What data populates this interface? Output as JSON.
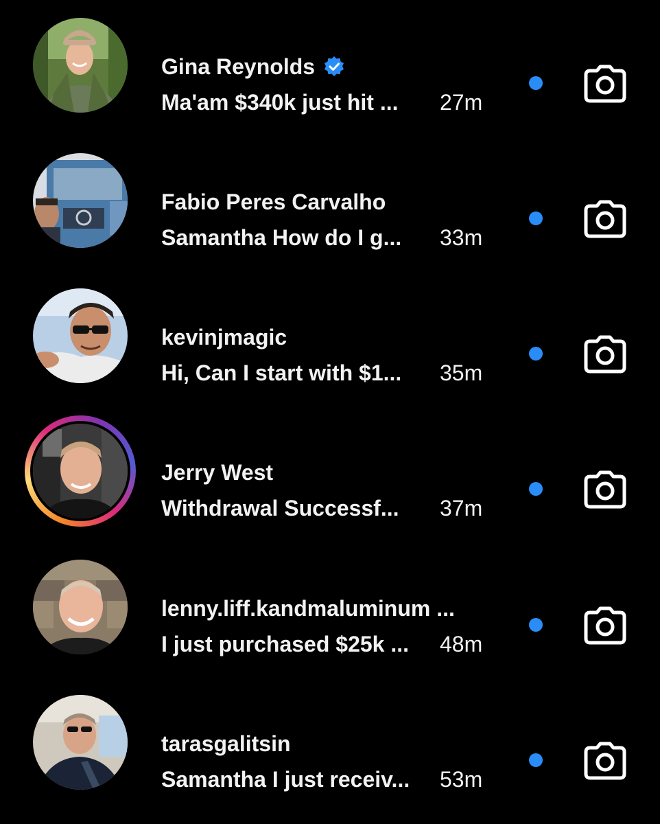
{
  "conversations": [
    {
      "name": "Gina Reynolds",
      "verified": true,
      "preview": "Ma'am $340k just hit ...",
      "time": "27m",
      "unread": true,
      "has_story": false
    },
    {
      "name": "Fabio Peres Carvalho",
      "verified": false,
      "preview": "Samantha How do I g...",
      "time": "33m",
      "unread": true,
      "has_story": false
    },
    {
      "name": "kevinjmagic",
      "verified": false,
      "preview": "Hi, Can I start with $1...",
      "time": "35m",
      "unread": true,
      "has_story": false
    },
    {
      "name": "Jerry West",
      "verified": false,
      "preview": "Withdrawal Successf...",
      "time": "37m",
      "unread": true,
      "has_story": true
    },
    {
      "name": "lenny.liff.kandmaluminum ...",
      "verified": false,
      "preview": "I just purchased $25k ...",
      "time": "48m",
      "unread": true,
      "has_story": false
    },
    {
      "name": "tarasgalitsin",
      "verified": false,
      "preview": "Samantha I just receiv...",
      "time": "53m",
      "unread": true,
      "has_story": false
    }
  ],
  "icons": {
    "verified": "verified-badge-icon",
    "camera": "camera-icon"
  },
  "colors": {
    "background": "#000000",
    "text": "#f2f2f2",
    "unread_dot": "#2a8df7",
    "verified_badge": "#2a8df7"
  }
}
